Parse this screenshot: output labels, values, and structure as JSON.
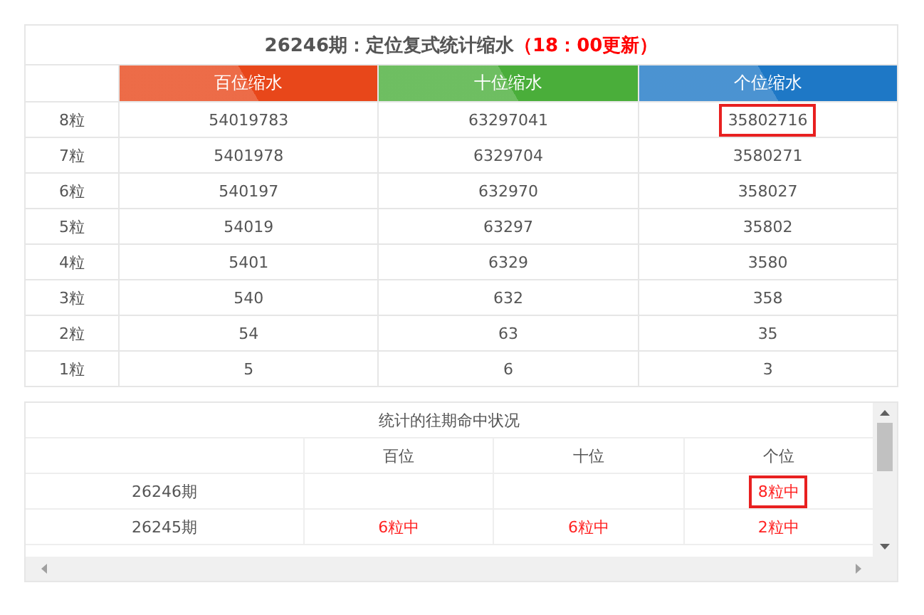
{
  "summary": {
    "title": "26246期：定位复式统计缩水",
    "update_note": "（18：00更新）",
    "columns": [
      {
        "label": "百位缩水",
        "color": "#e8471a"
      },
      {
        "label": "十位缩水",
        "color": "#4aae3a"
      },
      {
        "label": "个位缩水",
        "color": "#1e78c6"
      }
    ],
    "rows": [
      {
        "label": "8粒",
        "cells": [
          {
            "text": "54019783",
            "highlighted": false
          },
          {
            "text": "63297041",
            "highlighted": false
          },
          {
            "text": "35802716",
            "highlighted": true
          }
        ]
      },
      {
        "label": "7粒",
        "cells": [
          {
            "text": "5401978",
            "highlighted": false
          },
          {
            "text": "6329704",
            "highlighted": false
          },
          {
            "text": "3580271",
            "highlighted": false
          }
        ]
      },
      {
        "label": "6粒",
        "cells": [
          {
            "text": "540197",
            "highlighted": false
          },
          {
            "text": "632970",
            "highlighted": false
          },
          {
            "text": "358027",
            "highlighted": false
          }
        ]
      },
      {
        "label": "5粒",
        "cells": [
          {
            "text": "54019",
            "highlighted": false
          },
          {
            "text": "63297",
            "highlighted": false
          },
          {
            "text": "35802",
            "highlighted": false
          }
        ]
      },
      {
        "label": "4粒",
        "cells": [
          {
            "text": "5401",
            "highlighted": false
          },
          {
            "text": "6329",
            "highlighted": false
          },
          {
            "text": "3580",
            "highlighted": false
          }
        ]
      },
      {
        "label": "3粒",
        "cells": [
          {
            "text": "540",
            "highlighted": false
          },
          {
            "text": "632",
            "highlighted": false
          },
          {
            "text": "358",
            "highlighted": false
          }
        ]
      },
      {
        "label": "2粒",
        "cells": [
          {
            "text": "54",
            "highlighted": false
          },
          {
            "text": "63",
            "highlighted": false
          },
          {
            "text": "35",
            "highlighted": false
          }
        ]
      },
      {
        "label": "1粒",
        "cells": [
          {
            "text": "5",
            "highlighted": false
          },
          {
            "text": "6",
            "highlighted": false
          },
          {
            "text": "3",
            "highlighted": false
          }
        ]
      }
    ]
  },
  "history": {
    "title": "统计的往期命中状况",
    "columns": [
      "百位",
      "十位",
      "个位"
    ],
    "rows": [
      {
        "label": "26246期",
        "cells": [
          {},
          {},
          {
            "text": "8粒中",
            "highlighted": true
          }
        ]
      },
      {
        "label": "26245期",
        "cells": [
          {
            "text": "6粒中",
            "highlighted": false
          },
          {
            "text": "6粒中",
            "highlighted": false
          },
          {
            "text": "2粒中",
            "highlighted": false
          }
        ]
      }
    ]
  }
}
